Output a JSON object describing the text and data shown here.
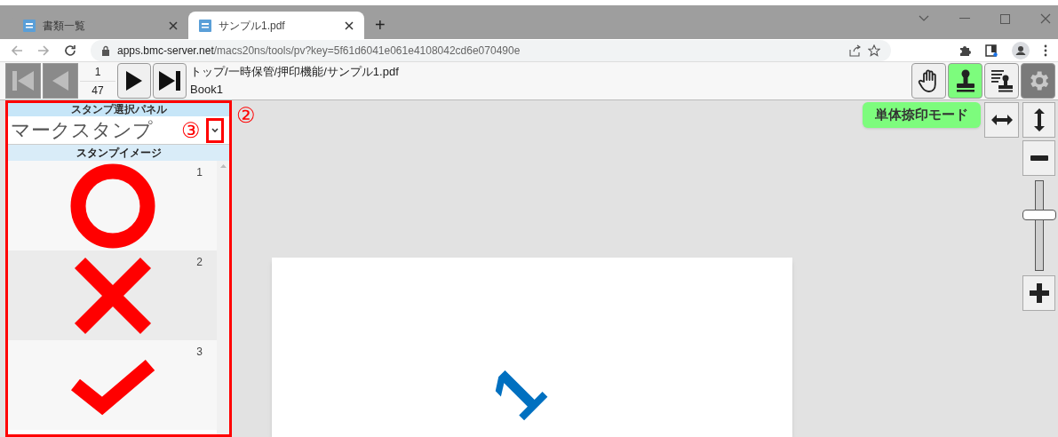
{
  "browser": {
    "tabs": [
      {
        "title": "書類一覧",
        "selected": false
      },
      {
        "title": "サンプル1.pdf",
        "selected": true
      }
    ],
    "new_tab": "+",
    "url_host": "apps.bmc-server.net",
    "url_path": "/macs20ns/tools/pv?key=5f61d6041e061e4108042cd6e070490e"
  },
  "toolbar": {
    "nav": [
      {
        "kind": "first",
        "disabled": true
      },
      {
        "kind": "prev",
        "disabled": true
      }
    ],
    "page_current": "1",
    "page_total": "47",
    "nav_next": [
      {
        "kind": "next",
        "disabled": false
      },
      {
        "kind": "last",
        "disabled": false
      }
    ],
    "path": "トップ/一時保管/押印機能/サンプル1.pdf",
    "book": "Book1",
    "tools": [
      {
        "kind": "hand",
        "selected": false
      },
      {
        "kind": "stamp",
        "selected": true
      },
      {
        "kind": "multi",
        "selected": false
      },
      {
        "kind": "settings",
        "selected": false,
        "disabled": true
      }
    ]
  },
  "panel": {
    "title": "スタンプ選択パネル",
    "select_value": "マークスタンプ",
    "annotation_3": "③",
    "annotation_2": "②",
    "images_title": "スタンプイメージ",
    "stamps": [
      {
        "number": "1",
        "kind": "circle",
        "selected": false
      },
      {
        "number": "2",
        "kind": "cross",
        "selected": true
      },
      {
        "number": "3",
        "kind": "check",
        "selected": false
      }
    ]
  },
  "mode_badge": "単体捺印モード",
  "zoom": {
    "level": 0.65
  },
  "document": {
    "stamp_text": "1"
  }
}
